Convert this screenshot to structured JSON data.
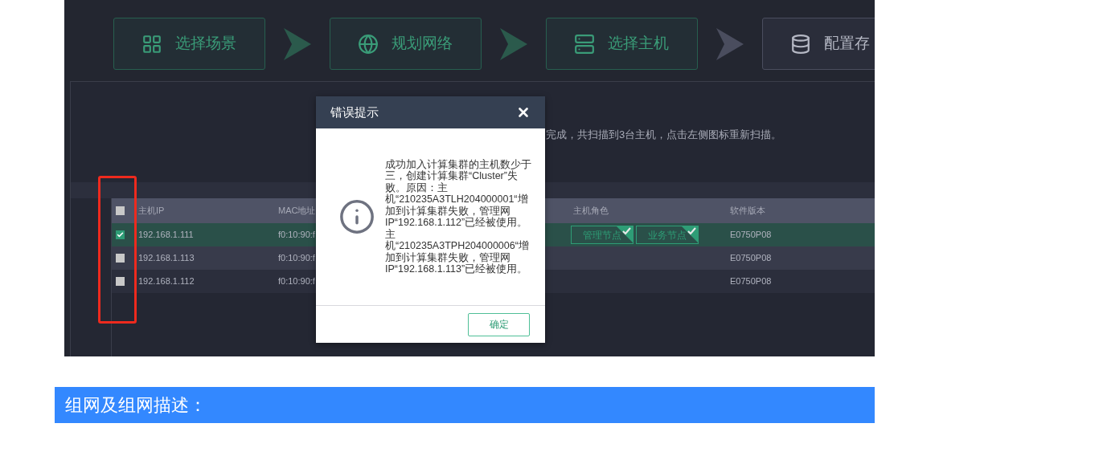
{
  "steps": [
    {
      "label": "选择场景",
      "active": true
    },
    {
      "label": "规划网络",
      "active": true
    },
    {
      "label": "选择主机",
      "active": true
    },
    {
      "label": "配置存",
      "active": false
    }
  ],
  "scan_message": "完成，共扫描到3台主机，点击左侧图标重新扫描。",
  "table": {
    "header_checked": false,
    "columns": [
      "主机IP",
      "MAC地址",
      "主机角色",
      "软件版本"
    ],
    "rows": [
      {
        "checked": true,
        "selected": true,
        "ip": "192.168.1.111",
        "mac": "f0:10:90:f",
        "roles": [
          {
            "label": "管理节点",
            "checked": true
          },
          {
            "label": "业务节点",
            "checked": true
          }
        ],
        "version": "E0750P08"
      },
      {
        "checked": false,
        "selected": false,
        "ip": "192.168.1.113",
        "mac": "f0:10:90:f",
        "roles": [],
        "version": "E0750P08"
      },
      {
        "checked": false,
        "selected": false,
        "ip": "192.168.1.112",
        "mac": "f0:10:90:f",
        "roles": [],
        "version": "E0750P08"
      }
    ]
  },
  "dialog": {
    "title": "错误提示",
    "message": "成功加入计算集群的主机数少于三，创建计算集群“Cluster”失败。原因：主机“210235A3TLH204000001“增加到计算集群失败，管理网IP“192.168.1.112”已经被使用。主机“210235A3TPH204000006“增加到计算集群失败，管理网IP“192.168.1.113”已经被使用。",
    "ok": "确定"
  },
  "section_heading": "组网及组网描述："
}
